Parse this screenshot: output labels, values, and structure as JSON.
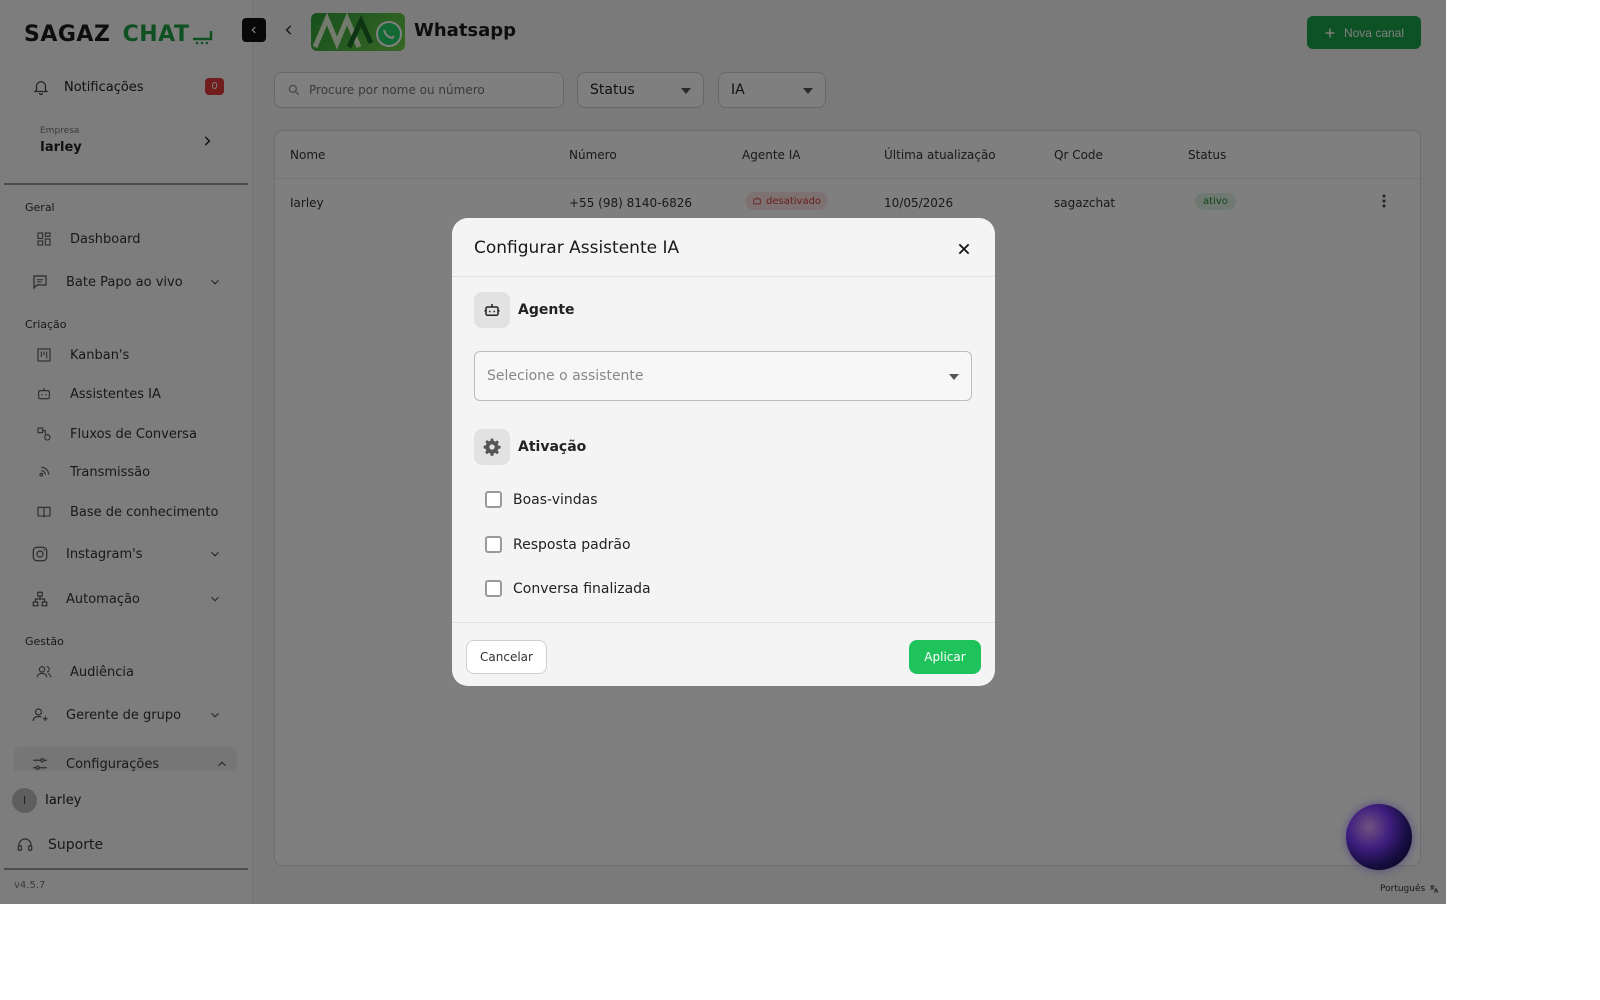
{
  "brand": {
    "part1": "SAGAZ",
    "part2": "CHAT"
  },
  "colors": {
    "accent_green": "#1aa54b",
    "apply_green": "#1fc35c",
    "danger": "#e23b3b",
    "overlay": "rgba(0,0,0,0.5)"
  },
  "sidebar": {
    "notifications": {
      "label": "Notificações",
      "count": "0",
      "icon": "bell-icon"
    },
    "company": {
      "caption": "Empresa",
      "name": "Iarley"
    },
    "sections": {
      "geral": "Geral",
      "criacao": "Criação",
      "gestao": "Gestão"
    },
    "items": {
      "dashboard": "Dashboard",
      "bate_papo": "Bate Papo ao vivo",
      "kanbans": "Kanban's",
      "assistentes": "Assistentes IA",
      "fluxos": "Fluxos de Conversa",
      "transmissao": "Transmissão",
      "base": "Base de conhecimento",
      "instagrams": "Instagram's",
      "automacao": "Automação",
      "audiencia": "Audiência",
      "gerente": "Gerente de grupo",
      "configuracoes": "Configurações"
    },
    "user": {
      "initial": "I",
      "name": "Iarley"
    },
    "support": "Suporte",
    "version": "v4.5.7"
  },
  "header": {
    "title": "Whatsapp",
    "new_channel": "Nova canal"
  },
  "filters": {
    "search_placeholder": "Procure por nome ou número",
    "status": "Status",
    "ia": "IA"
  },
  "table": {
    "headers": {
      "nome": "Nome",
      "numero": "Número",
      "agente": "Agente IA",
      "atualizacao": "Última atualização",
      "qrcode": "Qr Code",
      "status": "Status"
    },
    "rows": [
      {
        "nome": "Iarley",
        "numero": "+55 (98) 8140-6826",
        "agente": "desativado",
        "atualizacao": "10/05/2026",
        "qrcode": "sagazchat",
        "status": "ativo"
      }
    ]
  },
  "language": "Português",
  "modal": {
    "title": "Configurar Assistente IA",
    "agent_section": "Agente",
    "assistant_placeholder": "Selecione o assistente",
    "activation_section": "Ativação",
    "checkboxes": [
      "Boas-vindas",
      "Resposta padrão",
      "Conversa finalizada"
    ],
    "cancel": "Cancelar",
    "apply": "Aplicar"
  }
}
